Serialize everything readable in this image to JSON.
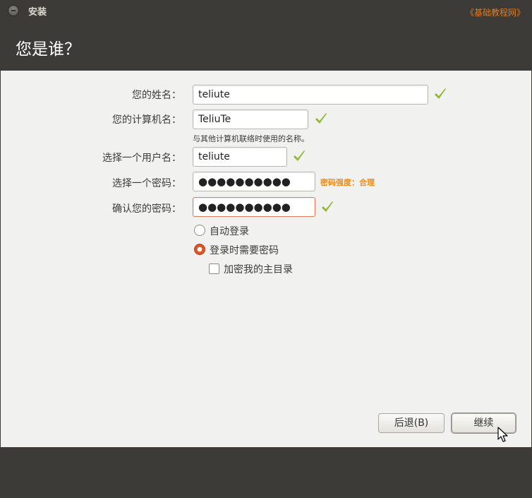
{
  "window": {
    "title": "安装",
    "watermark": "《基础教程网》"
  },
  "page": {
    "title": "您是谁？"
  },
  "form": {
    "name_label": "您的姓名：",
    "name_value": "teliute",
    "computer_label": "您的计算机名：",
    "computer_value": "TeliuTe",
    "computer_hint": "与其他计算机联络时使用的名称。",
    "username_label": "选择一个用户名：",
    "username_value": "teliute",
    "password_label": "选择一个密码：",
    "password_value": "●●●●●●●●●●",
    "password_strength": "密码强度：合理",
    "confirm_label": "确认您的密码：",
    "confirm_value": "●●●●●●●●●●"
  },
  "options": {
    "auto_login": "自动登录",
    "require_password": "登录时需要密码",
    "encrypt_home": "加密我的主目录",
    "selected": "require_password"
  },
  "buttons": {
    "back": "后退(B)",
    "continue": "继续"
  },
  "icons": {
    "valid": "check-icon",
    "window_menu": "window-menu-icon",
    "cursor": "mouse-pointer-icon"
  },
  "colors": {
    "accent": "#dd4814",
    "check": "#8fb935",
    "strength": "#f28a16",
    "chrome": "#3c3b37"
  }
}
